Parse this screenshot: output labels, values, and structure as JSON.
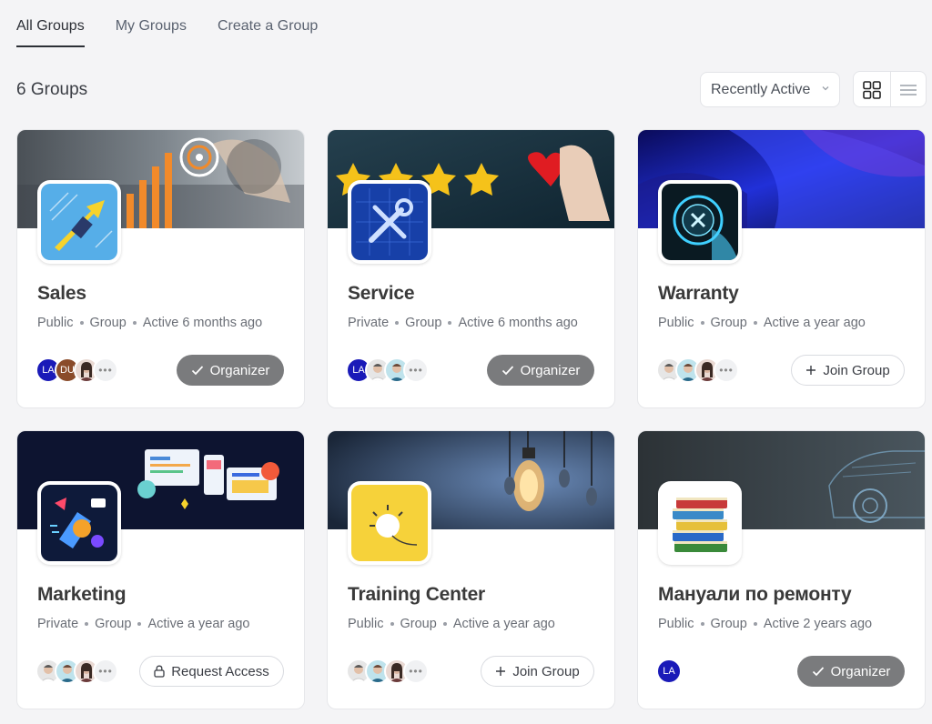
{
  "tabs": [
    {
      "label": "All Groups",
      "active": true
    },
    {
      "label": "My Groups",
      "active": false
    },
    {
      "label": "Create a Group",
      "active": false
    }
  ],
  "group_count": "6 Groups",
  "sort": {
    "selected": "Recently Active"
  },
  "groups": [
    {
      "name": "Sales",
      "privacy": "Public",
      "type": "Group",
      "activity": "Active 6 months ago",
      "action": "Organizer",
      "members": [
        "LA",
        "DU",
        "",
        "•••"
      ]
    },
    {
      "name": "Service",
      "privacy": "Private",
      "type": "Group",
      "activity": "Active 6 months ago",
      "action": "Organizer",
      "members": [
        "LA",
        "",
        "",
        "•••"
      ]
    },
    {
      "name": "Warranty",
      "privacy": "Public",
      "type": "Group",
      "activity": "Active a year ago",
      "action": "Join Group",
      "members": [
        "",
        "",
        "",
        "•••"
      ]
    },
    {
      "name": "Marketing",
      "privacy": "Private",
      "type": "Group",
      "activity": "Active a year ago",
      "action": "Request Access",
      "members": [
        "",
        "",
        "",
        "•••"
      ]
    },
    {
      "name": "Training Center",
      "privacy": "Public",
      "type": "Group",
      "activity": "Active a year ago",
      "action": "Join Group",
      "members": [
        "",
        "",
        "",
        "•••"
      ]
    },
    {
      "name": "Мануали по ремонту",
      "privacy": "Public",
      "type": "Group",
      "activity": "Active 2 years ago",
      "action": "Organizer",
      "members": [
        "LA"
      ]
    }
  ],
  "colors": {
    "organizer_bg": "#7a7b7d",
    "la_avatar": "#1a1ab8",
    "du_avatar": "#8a4b2a"
  }
}
